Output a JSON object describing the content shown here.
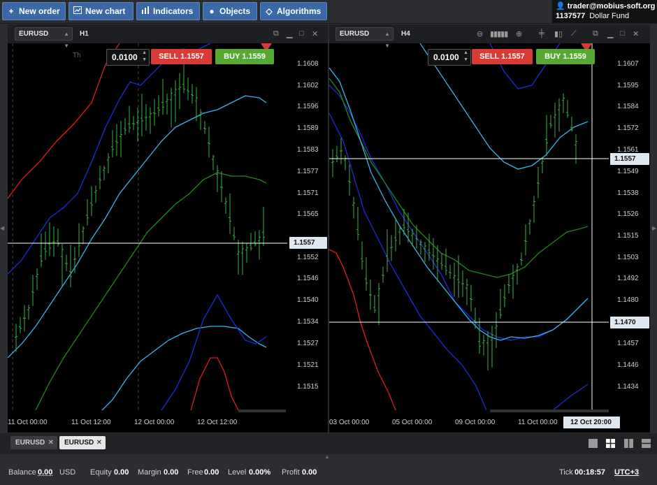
{
  "toolbar": {
    "new_order": "New order",
    "new_chart": "New chart",
    "indicators": "Indicators",
    "objects": "Objects",
    "algorithms": "Algorithms"
  },
  "account": {
    "email": "trader@mobius-soft.org",
    "id": "1137577",
    "name": "Dollar Fund"
  },
  "chart_left": {
    "symbol": "EURUSD",
    "timeframe": "H1",
    "day_label": "Th",
    "lot": "0.0100",
    "sell_label": "SELL",
    "sell_price": "1.1557",
    "buy_label": "BUY",
    "buy_price": "1.1559",
    "current_price": "1.1557",
    "price_ticks": [
      "1.1608",
      "1.1602",
      "1.1596",
      "1.1589",
      "1.1583",
      "1.1577",
      "1.1571",
      "1.1565",
      "1.1552",
      "1.1546",
      "1.1540",
      "1.1534",
      "1.1527",
      "1.1521",
      "1.1515"
    ],
    "time_ticks": [
      "11 Oct 00:00",
      "11 Oct 12:00",
      "12 Oct 00:00",
      "12 Oct 12:00"
    ]
  },
  "chart_right": {
    "symbol": "EURUSD",
    "timeframe": "H4",
    "lot": "0.0100",
    "sell_label": "SELL",
    "sell_price": "1.1557",
    "buy_label": "BUY",
    "buy_price": "1.1559",
    "current_price": "1.1557",
    "line_price": "1.1470",
    "crosshair_time": "12 Oct 20:00",
    "price_ticks": [
      "1.1607",
      "1.1595",
      "1.1584",
      "1.1572",
      "1.1561",
      "1.1549",
      "1.1538",
      "1.1526",
      "1.1515",
      "1.1503",
      "1.1492",
      "1.1480",
      "1.1457",
      "1.1446",
      "1.1434"
    ],
    "time_ticks": [
      "03 Oct 00:00",
      "05 Oct 00:00",
      "09 Oct 00:00",
      "11 Oct 00:00"
    ]
  },
  "tabs": [
    {
      "label": "EURUSD",
      "active": false
    },
    {
      "label": "EURUSD",
      "active": true
    }
  ],
  "status": {
    "balance_label": "Balance",
    "balance_value": "0.00",
    "currency": "USD",
    "equity_label": "Equity",
    "equity_value": "0.00",
    "margin_label": "Margin",
    "margin_value": "0.00",
    "free_label": "Free",
    "free_value": "0.00",
    "level_label": "Level",
    "level_value": "0.00%",
    "profit_label": "Profit",
    "profit_value": "0.00",
    "tick_label": "Tick",
    "tick_value": "00:18:57",
    "timezone": "UTC+3"
  },
  "colors": {
    "buy": "#56a832",
    "sell": "#d83b35",
    "toolbar_button": "#3c68a6",
    "candle": "#3cb043",
    "band_blue": "#1a2fd8",
    "band_cyan": "#35b6ee",
    "band_green": "#1e8a1e",
    "band_red": "#e01e1e"
  }
}
